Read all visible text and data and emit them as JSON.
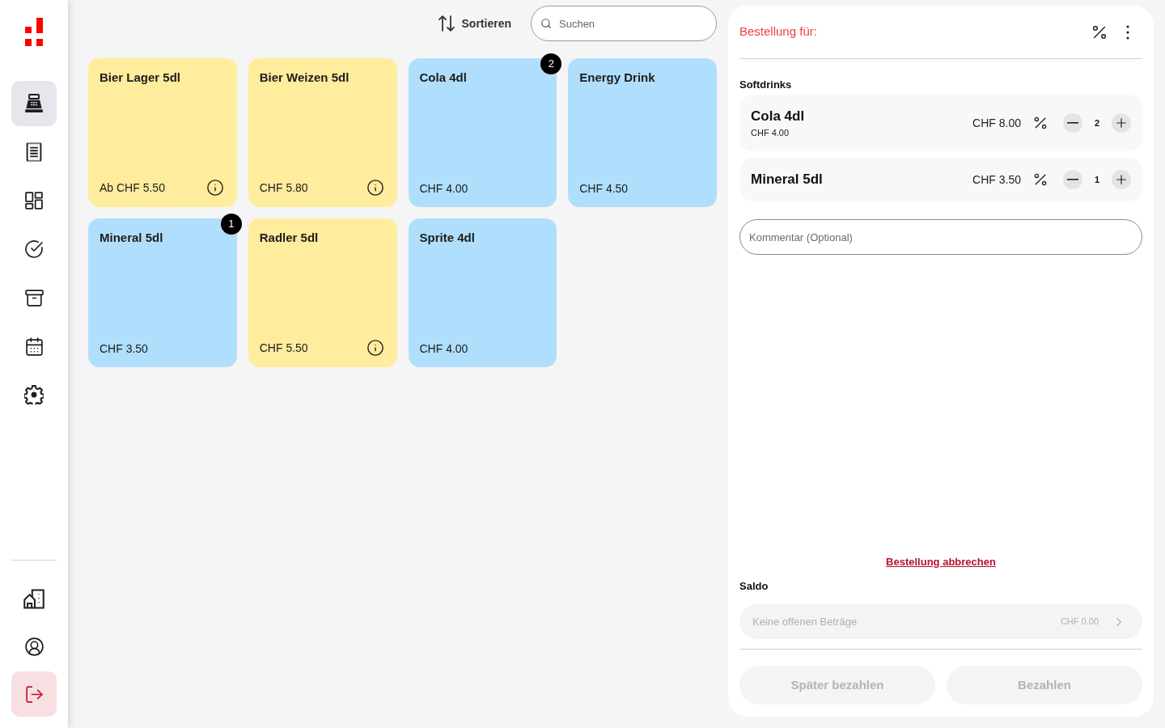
{
  "sidebar": {
    "nav_items": [
      {
        "selected": true
      },
      {
        "selected": false
      },
      {
        "selected": false
      },
      {
        "selected": false
      },
      {
        "selected": false
      },
      {
        "selected": false
      },
      {
        "selected": false
      }
    ],
    "bottom_items": [
      {
        "kind": "default",
        "selected": false
      },
      {
        "kind": "default",
        "selected": false
      },
      {
        "kind": "danger",
        "selected": true
      }
    ]
  },
  "toolbar": {
    "sort_label": "Sortieren",
    "search": {
      "placeholder": "Suchen"
    }
  },
  "products": [
    {
      "name": "Bier Lager 5dl",
      "price": "Ab CHF 5.50",
      "color": "#ffec9c",
      "info": true
    },
    {
      "name": "Bier Weizen 5dl",
      "price": "CHF 5.80",
      "color": "#ffec9c",
      "info": true
    },
    {
      "name": "Cola 4dl",
      "price": "CHF 4.00",
      "color": "#b0dffd",
      "info": false,
      "badge": "2"
    },
    {
      "name": "Energy Drink",
      "price": "CHF 4.50",
      "color": "#b0dffd",
      "info": false
    },
    {
      "name": "Mineral 5dl",
      "price": "CHF 3.50",
      "color": "#b0dffd",
      "info": false,
      "badge": "1"
    },
    {
      "name": "Radler 5dl",
      "price": "CHF 5.50",
      "color": "#ffec9c",
      "info": true
    },
    {
      "name": "Sprite 4dl",
      "price": "CHF 4.00",
      "color": "#b0dffd",
      "info": false
    }
  ],
  "order": {
    "title": "Bestellung für:",
    "groups": [
      {
        "name": "Softdrinks",
        "items": [
          {
            "name": "Cola 4dl",
            "unit_price": "CHF 4.00",
            "total": "CHF 8.00",
            "quantity": "2"
          },
          {
            "name": "Mineral 5dl",
            "total": "CHF 3.50",
            "quantity": "1"
          }
        ]
      }
    ],
    "comment": {
      "placeholder": "Kommentar (Optional)"
    },
    "cancel_link": "Bestellung abbrechen",
    "saldo": {
      "label": "Saldo",
      "text": "Keine offenen Beträge",
      "amount": "CHF 0.00",
      "disabled": true
    },
    "buttons": [
      {
        "label": "Später bezahlen",
        "disabled": true
      },
      {
        "label": "Bezahlen",
        "disabled": true
      }
    ]
  }
}
